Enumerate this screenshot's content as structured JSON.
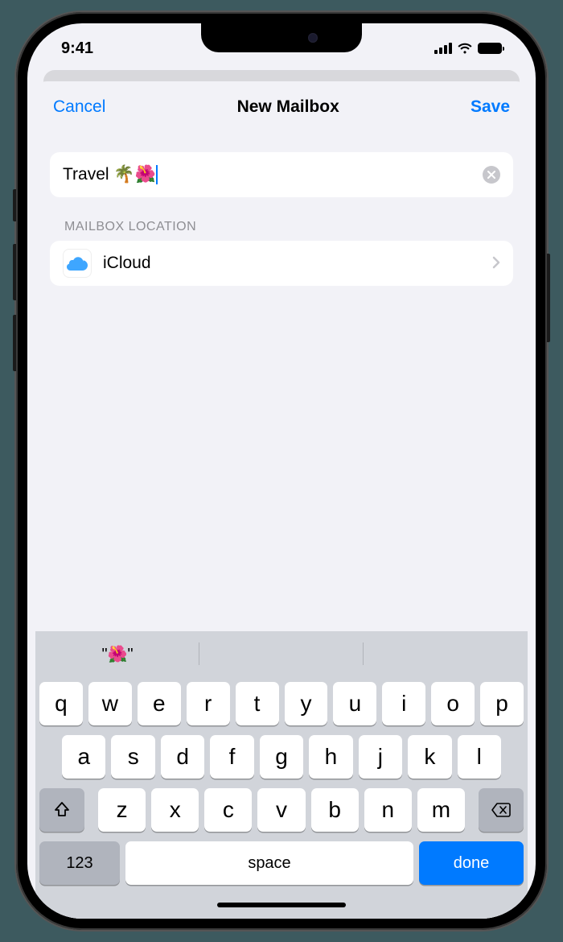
{
  "status": {
    "time": "9:41"
  },
  "nav": {
    "cancel": "Cancel",
    "title": "New Mailbox",
    "save": "Save"
  },
  "mailbox": {
    "name_value": "Travel 🌴🌺",
    "section_label": "MAILBOX LOCATION",
    "location_name": "iCloud"
  },
  "suggestions": [
    "\"🌺\"",
    "",
    ""
  ],
  "keyboard": {
    "row1": [
      "q",
      "w",
      "e",
      "r",
      "t",
      "y",
      "u",
      "i",
      "o",
      "p"
    ],
    "row2": [
      "a",
      "s",
      "d",
      "f",
      "g",
      "h",
      "j",
      "k",
      "l"
    ],
    "row3": [
      "z",
      "x",
      "c",
      "v",
      "b",
      "n",
      "m"
    ],
    "numbers_key": "123",
    "space_key": "space",
    "return_key": "done"
  }
}
